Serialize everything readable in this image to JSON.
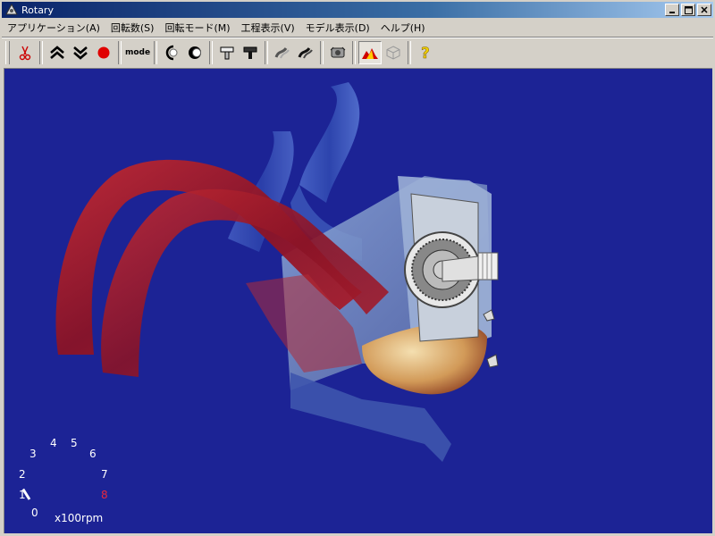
{
  "window": {
    "title": "Rotary",
    "buttons": [
      "minimize",
      "maximize",
      "close"
    ]
  },
  "menu": [
    {
      "label": "アプリケーション(A)"
    },
    {
      "label": "回転数(S)"
    },
    {
      "label": "回転モード(M)"
    },
    {
      "label": "工程表示(V)"
    },
    {
      "label": "モデル表示(D)"
    },
    {
      "label": "ヘルプ(H)"
    }
  ],
  "toolbar": {
    "mode_label": "mode",
    "buttons": [
      "cut-icon",
      "speed-up-icon",
      "speed-down-icon",
      "stop-icon",
      "mode-button",
      "rotate-left-icon",
      "rotate-right-icon",
      "stamp-up-icon",
      "stamp-down-icon",
      "spark-left-icon",
      "spark-right-icon",
      "engine-icon",
      "flame-icon",
      "cube-icon",
      "help-icon"
    ]
  },
  "gauge": {
    "labels": [
      "0",
      "1",
      "2",
      "3",
      "4",
      "5",
      "6",
      "7",
      "8"
    ],
    "redline_label": "8",
    "unit": "x100rpm",
    "needle_value": 1.1,
    "max": 8
  },
  "colors": {
    "viewport_bg": "#1c2395",
    "titlebar": "#0a246a",
    "redline": "#e8283c"
  }
}
